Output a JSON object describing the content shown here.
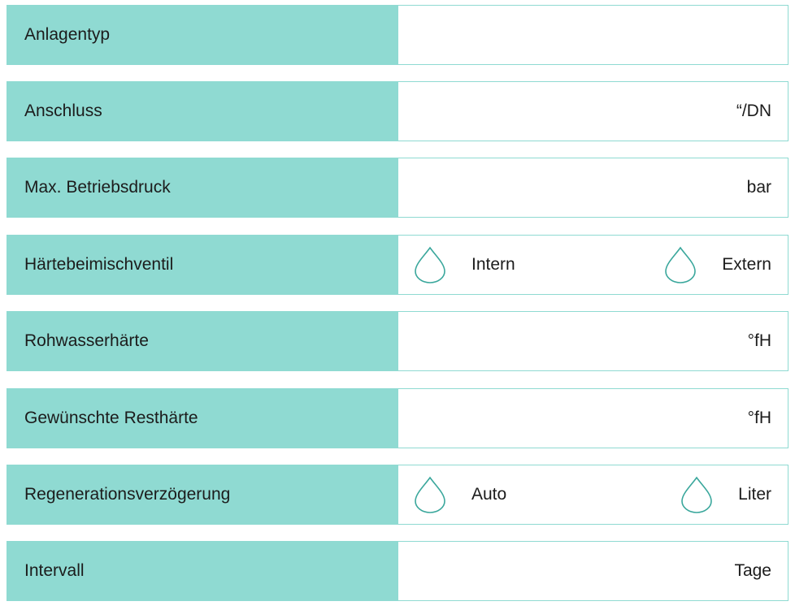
{
  "rows": [
    {
      "label": "Anlagentyp",
      "unit": ""
    },
    {
      "label": "Anschluss",
      "unit": "“/DN"
    },
    {
      "label": "Max. Betriebsdruck",
      "unit": "bar"
    },
    {
      "label": "Härtebeimischventil",
      "options": [
        "Intern",
        "Extern"
      ]
    },
    {
      "label": "Rohwasserhärte",
      "unit": "°fH"
    },
    {
      "label": "Gewünschte Resthärte",
      "unit": "°fH"
    },
    {
      "label": "Regenerationsverzögerung",
      "options": [
        "Auto",
        "Liter"
      ]
    },
    {
      "label": "Intervall",
      "unit": "Tage"
    }
  ],
  "colors": {
    "accent": "#8fdad2"
  },
  "icons": {
    "option": "drop-icon"
  }
}
